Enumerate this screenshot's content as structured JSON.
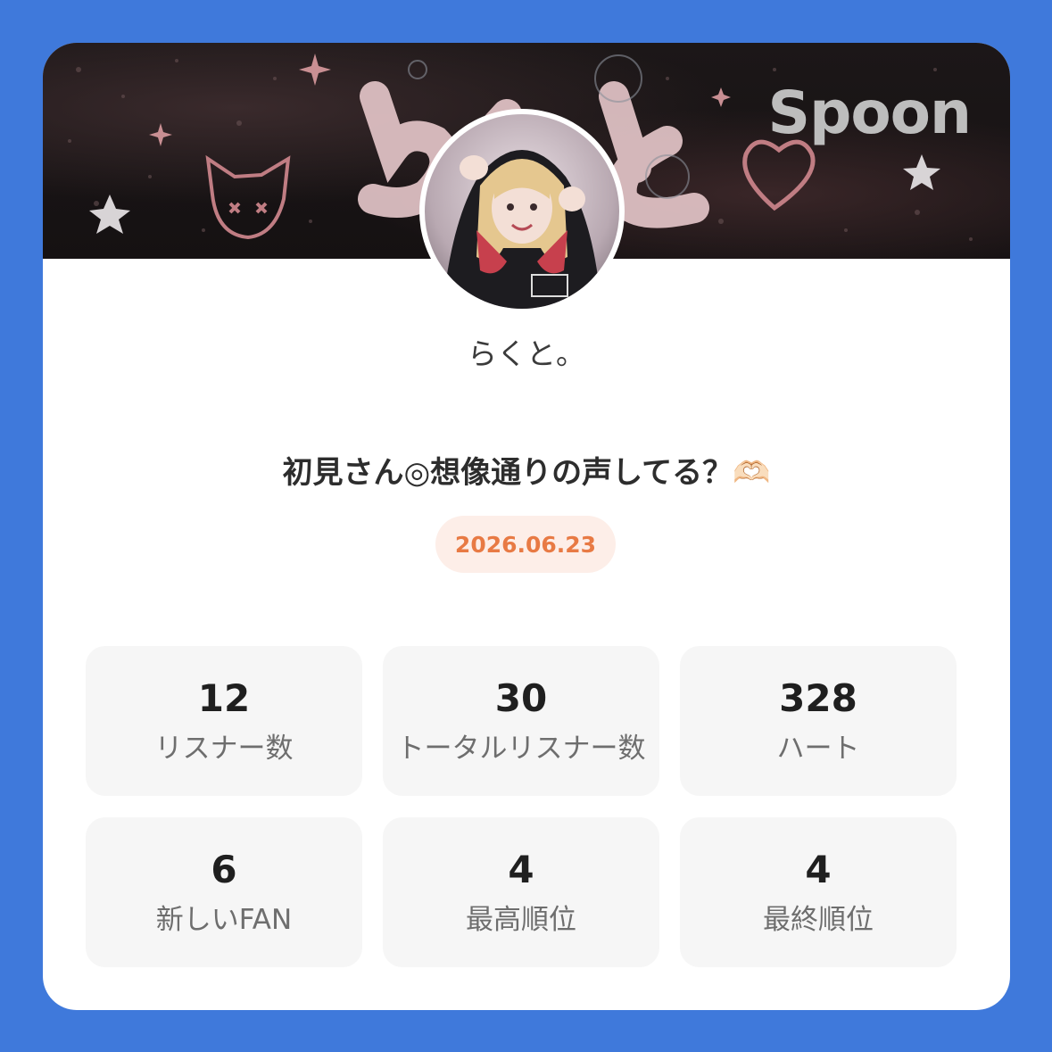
{
  "brand": {
    "logo_text": "Spoon"
  },
  "banner": {
    "art_text": "らくと"
  },
  "profile": {
    "nickname": "らくと。"
  },
  "live": {
    "title": "初見さん◎想像通りの声してる？🫶🏻",
    "date": "2026.06.23"
  },
  "stats": [
    {
      "value": "12",
      "label": "リスナー数"
    },
    {
      "value": "30",
      "label": "トータルリスナー数"
    },
    {
      "value": "328",
      "label": "ハート"
    },
    {
      "value": "6",
      "label": "新しいFAN"
    },
    {
      "value": "4",
      "label": "最高順位"
    },
    {
      "value": "4",
      "label": "最終順位"
    }
  ],
  "colors": {
    "background": "#3f79db",
    "card": "#ffffff",
    "accent": "#e87a44",
    "badge_bg": "#fdeee8",
    "stat_bg": "#f6f6f6"
  }
}
